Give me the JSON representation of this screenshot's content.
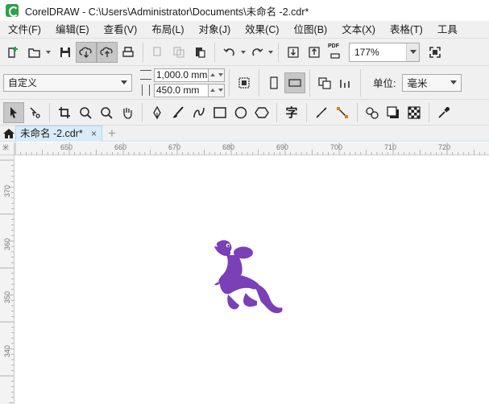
{
  "app": {
    "title": "CorelDRAW - C:\\Users\\Administrator\\Documents\\未命名 -2.cdr*"
  },
  "menu": [
    "文件(F)",
    "编辑(E)",
    "查看(V)",
    "布局(L)",
    "对象(J)",
    "效果(C)",
    "位图(B)",
    "文本(X)",
    "表格(T)",
    "工具"
  ],
  "standard_toolbar": {
    "zoom_value": "177%",
    "pdf_label": "PDF"
  },
  "property_bar": {
    "page_preset": "自定义",
    "width_value": "1,000.0 mm",
    "height_value": "450.0 mm",
    "units_label": "单位:",
    "units_value": "毫米"
  },
  "tools": {
    "text_tool_glyph": "字"
  },
  "document_tab": {
    "label": "未命名 -2.cdr*",
    "close_glyph": "×",
    "add_glyph": "+"
  },
  "ruler": {
    "horizontal_ticks": [
      "650",
      "660",
      "670",
      "680",
      "690",
      "700",
      "710",
      "720"
    ],
    "vertical_ticks": [
      "370",
      "360",
      "350",
      "340"
    ],
    "corner_mark": "米"
  },
  "colors": {
    "accent": "#2fa14a",
    "dinosaur": "#7b3fb8",
    "active_tab": "#d9ebf9"
  }
}
